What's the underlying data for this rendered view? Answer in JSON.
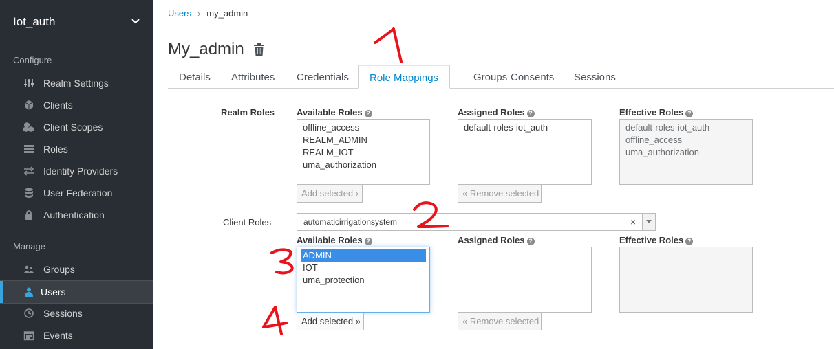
{
  "sidebar": {
    "realm": "Iot_auth",
    "configure_label": "Configure",
    "manage_label": "Manage",
    "configure_items": [
      {
        "label": "Realm Settings",
        "icon": "sliders-icon"
      },
      {
        "label": "Clients",
        "icon": "cube-icon"
      },
      {
        "label": "Client Scopes",
        "icon": "cubes-icon"
      },
      {
        "label": "Roles",
        "icon": "list-icon"
      },
      {
        "label": "Identity Providers",
        "icon": "exchange-icon"
      },
      {
        "label": "User Federation",
        "icon": "database-icon"
      },
      {
        "label": "Authentication",
        "icon": "lock-icon"
      }
    ],
    "manage_items": [
      {
        "label": "Groups",
        "icon": "users-icon"
      },
      {
        "label": "Users",
        "icon": "user-icon",
        "active": true
      },
      {
        "label": "Sessions",
        "icon": "clock-icon"
      },
      {
        "label": "Events",
        "icon": "calendar-icon"
      }
    ]
  },
  "breadcrumb": {
    "parent": "Users",
    "separator": "›",
    "current": "my_admin"
  },
  "page_title": "My_admin",
  "tabs": [
    "Details",
    "Attributes",
    "Credentials",
    "Role Mappings",
    "Groups",
    "Consents",
    "Sessions"
  ],
  "active_tab": "Role Mappings",
  "realm_roles": {
    "label": "Realm Roles",
    "available_label": "Available Roles",
    "assigned_label": "Assigned Roles",
    "effective_label": "Effective Roles",
    "available": [
      "offline_access",
      "REALM_ADMIN",
      "REALM_IOT",
      "uma_authorization"
    ],
    "assigned": [
      "default-roles-iot_auth"
    ],
    "effective": [
      "default-roles-iot_auth",
      "offline_access",
      "uma_authorization"
    ],
    "add_button": "Add selected ›",
    "remove_button": "« Remove selected"
  },
  "client_roles": {
    "label": "Client Roles",
    "client_select": "automaticirrigationsystem",
    "clear_glyph": "×",
    "available_label": "Available Roles",
    "assigned_label": "Assigned Roles",
    "effective_label": "Effective Roles",
    "available": [
      "ADMIN",
      "IOT",
      "uma_protection"
    ],
    "selected": "ADMIN",
    "assigned": [],
    "effective": [],
    "add_button": "Add selected »",
    "remove_button": "« Remove selected"
  },
  "annotations": {
    "marks": [
      "1",
      "2",
      "3",
      "4"
    ],
    "color": "#e8141b"
  },
  "colors": {
    "sidebar_bg": "#292e34",
    "accent": "#0088ce",
    "selection": "#3b8ee8"
  }
}
